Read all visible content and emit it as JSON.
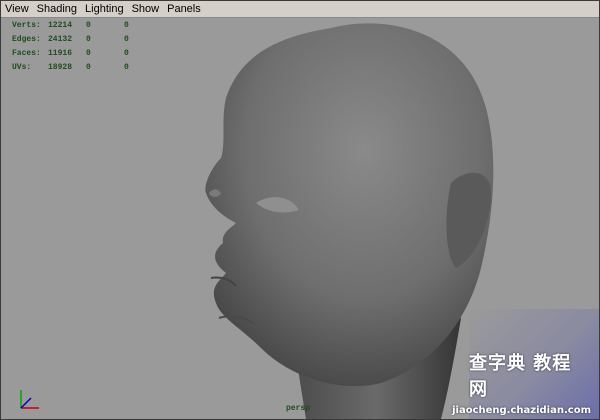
{
  "menu": [
    "View",
    "Shading",
    "Lighting",
    "Show",
    "Panels"
  ],
  "hud": [
    {
      "label": "Verts:",
      "value": "12214",
      "sel": "0",
      "sel2": "0"
    },
    {
      "label": "Edges:",
      "value": "24132",
      "sel": "0",
      "sel2": "0"
    },
    {
      "label": "Faces:",
      "value": "11916",
      "sel": "0",
      "sel2": "0"
    },
    {
      "label": "UVs:",
      "value": "18928",
      "sel": "0",
      "sel2": "0"
    }
  ],
  "camera_label": "persp",
  "axis": {
    "x": "x",
    "y": "y",
    "z": "z"
  },
  "watermark": {
    "cn": "查字典 教程网",
    "url": "jiaocheng.chazidian.com"
  },
  "colors": {
    "background": "#9a9a9a",
    "model": "#6e6e6e",
    "hud_text": "#1e4d1e"
  }
}
